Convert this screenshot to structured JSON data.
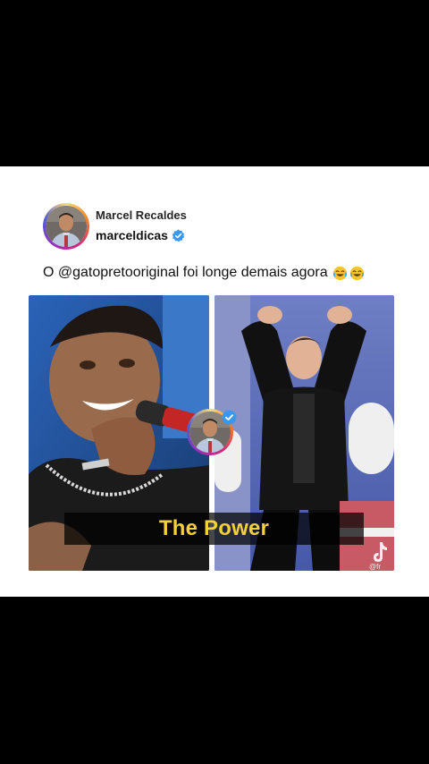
{
  "post": {
    "display_name": "Marcel Recaldes",
    "handle": "marceldicas",
    "verified_icon": "verified-badge-icon",
    "caption": "O @gatopretooriginal foi longe demais agora",
    "caption_emojis": [
      "face-with-tears-of-joy",
      "face-with-tears-of-joy"
    ]
  },
  "media": {
    "left_photo": "singer-with-microphone",
    "right_photo": "man-dancing-arms-raised",
    "subtitle": "The Power",
    "watermark_icon": "tiktok-icon",
    "watermark_text": "@fr"
  },
  "colors": {
    "background": "#000000",
    "card": "#ffffff",
    "verified_blue": "#3897f0",
    "subtitle_text": "#f5cf3b"
  }
}
